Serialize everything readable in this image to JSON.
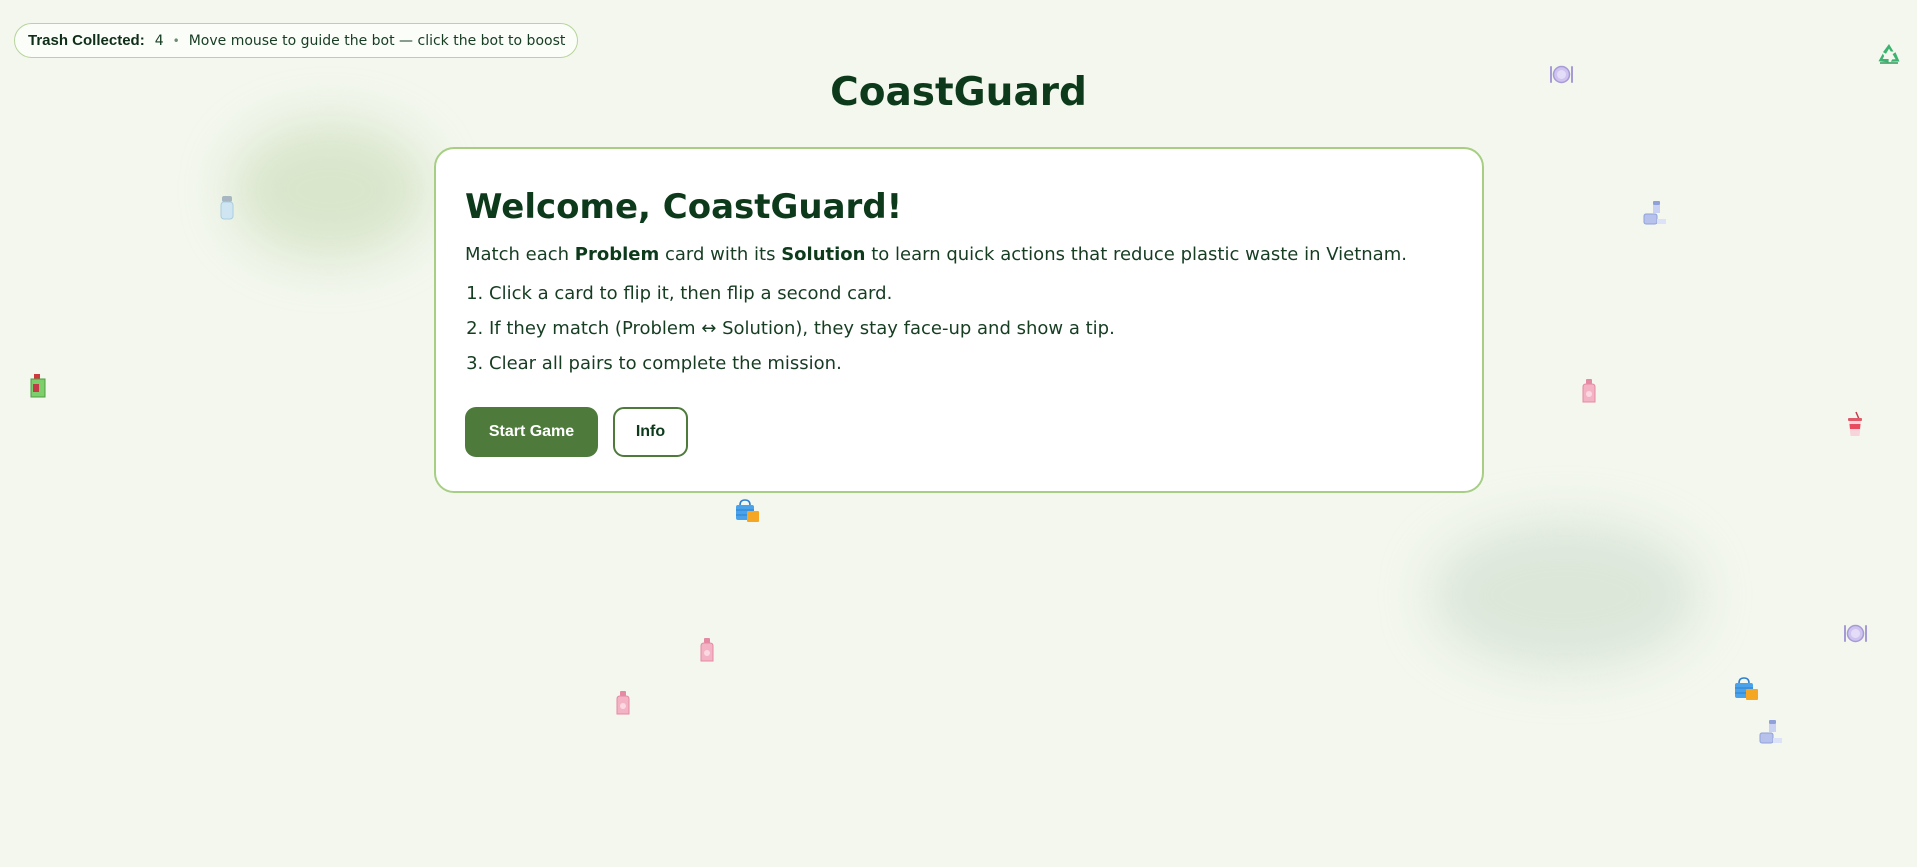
{
  "hud": {
    "counter_label": "Trash Collected:",
    "counter_value": "4",
    "separator": "•",
    "hint": "Move mouse to guide the bot — click the bot to boost"
  },
  "app_title": "CoastGuard",
  "welcome": {
    "heading": "Welcome, CoastGuard!",
    "intro_prefix": "Match each ",
    "intro_problem": "Problem",
    "intro_middle": " card with its ",
    "intro_solution": "Solution",
    "intro_suffix": " to learn quick actions that reduce plastic waste in Vietnam.",
    "steps": [
      "Click a card to flip it, then flip a second card.",
      "If they match (Problem ↔ Solution), they stay face-up and show a tip.",
      "Clear all pairs to complete the mission."
    ],
    "start_button": "Start Game",
    "info_button": "Info"
  },
  "icons": {
    "recycle": "recycle-icon",
    "floating_trash": [
      "plate-icon",
      "cup-icon",
      "jar-icon",
      "bottle-icon",
      "bag-icon",
      "carton-icon",
      "salt-shaker-icon"
    ]
  },
  "colors": {
    "background": "#f3f7ee",
    "accent": "#4e7b3b",
    "card_border": "#a6cf84",
    "text_dark": "#0c3a1a",
    "recycle": "#3cb371"
  }
}
